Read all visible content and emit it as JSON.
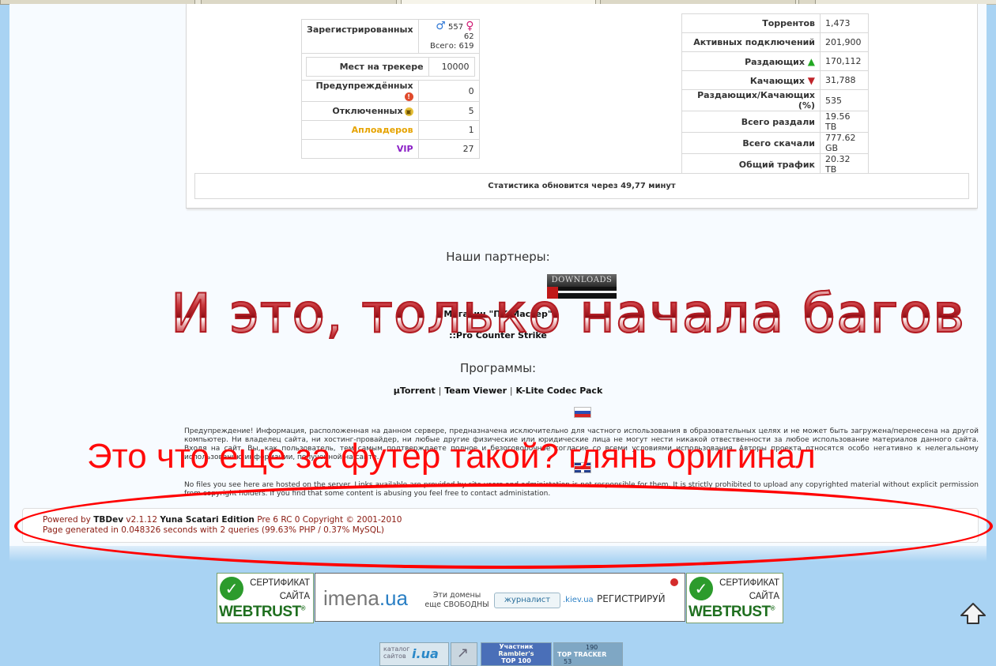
{
  "stats_left": {
    "registered_label": "Зарегистрированных",
    "male_count": "557",
    "female_count": "62",
    "total": "Всего: 619",
    "slots_label": "Мест на трекере",
    "slots_value": "10000",
    "rows": [
      {
        "label": "Предупреждённых",
        "value": "0",
        "icon": "warning-icon"
      },
      {
        "label": "Отключенных",
        "value": "5",
        "icon": "lock-icon"
      },
      {
        "label": "Аплоадеров",
        "value": "1",
        "color": "#e6a300"
      },
      {
        "label": "VIP",
        "value": "27",
        "color": "#8a1ec6"
      }
    ]
  },
  "stats_right": {
    "rows": [
      {
        "label": "Торрентов",
        "value": "1,473"
      },
      {
        "label": "Активных подключений",
        "value": "201,900"
      },
      {
        "label": "Раздающих",
        "value": "170,112",
        "icon": "arrow-up-icon"
      },
      {
        "label": "Качающих",
        "value": "31,788",
        "icon": "arrow-down-icon"
      },
      {
        "label": "Раздающих/Качающих (%)",
        "value": "535"
      },
      {
        "label": "Всего раздали",
        "value": "19.56 TB"
      },
      {
        "label": "Всего скачали",
        "value": "777.62 GB"
      },
      {
        "label": "Общий трафик",
        "value": "20.32 TB"
      }
    ]
  },
  "update_notice": "Статистика обновится через 49,77 минут",
  "partners": {
    "heading": "Наши партнеры:",
    "banner_text": "DOWNLOADS",
    "links": [
      "Магазин \"ПК Мастер\"",
      "::Pro Counter Strike"
    ]
  },
  "programs": {
    "heading": "Программы:",
    "links": [
      "µTorrent",
      "Team Viewer",
      "K-Lite Codec Pack"
    ],
    "separator": "|"
  },
  "disclaimer_ru": "Предупреждение! Информация, расположенная на данном сервере, предназначена исключительно для частного использования в образовательных целях и не может быть загружена/перенесена на другой компьютер. Ни владелец сайта, ни хостинг-провайдер, ни любые другие физические или юридические лица не могут нести никакой отвественности за любое использование материалов данного сайта. Входя на сайт, Вы, как пользователь, тем самым подтверждаете полное и безоговорочное согласие со всеми условиями использования. Авторы проекта относятся особо негативно к нелегальному использованию информации, полученной на сайте.",
  "disclaimer_en": "No files you see here are hosted on the server. Links available are provided by site users and administation is not responsible for them. It is strictly prohibited to upload any copyrighted material without explicit permission from copyright holders. If you find that some content is abusing you feel free to contact administation.",
  "footer": {
    "powered_prefix": "Powered by",
    "engine": "TBDev",
    "version": "v2.1.12",
    "edition": "Yuna Scatari Edition",
    "build": "Pre 6 RC 0 Copyright © 2001-2010",
    "generated": "Page generated in 0.048326 seconds with 2 queries (99.63% PHP / 0.37% MySQL)"
  },
  "annotations": {
    "big": "И это, только начала багов",
    "red": "Это что еще за футер такой? глянь оригинал",
    "color": "#ff0000"
  },
  "banners": {
    "webtrust_line1": "СЕРТИФИКАТ",
    "webtrust_line2": "САЙТА",
    "webtrust_brand": "WEBTRUST",
    "imena_logo_a": "imena",
    "imena_logo_b": ".ua",
    "imena_note": "Эти домены еще СВОБОДНЫ",
    "imena_input": "журналист",
    "imena_zone": ".kiev.ua",
    "imena_cta": "РЕГИСТРИРУЙ",
    "catalog_label": "каталог сайтов",
    "catalog_brand": "i.ua",
    "rambler_l1": "Участник",
    "rambler_l2": "Rambler's",
    "rambler_l3": "TOP 100",
    "toptracker_count": "190",
    "toptracker_label": "TOP TRACKER",
    "toptracker_sub": "53"
  }
}
